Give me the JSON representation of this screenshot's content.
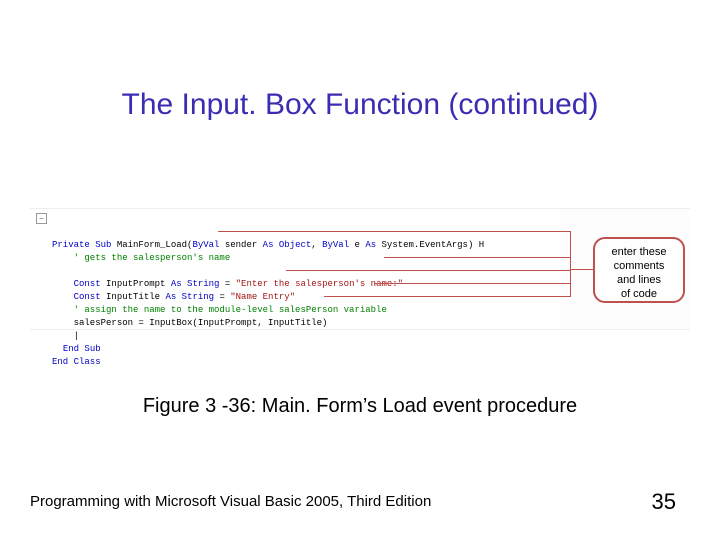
{
  "title": "The Input. Box Function (continued)",
  "code": {
    "collapse_glyph": "−",
    "line1": {
      "kw1": "Private Sub",
      "name": " MainForm_Load(",
      "kw2": "ByVal",
      "arg1": " sender ",
      "kw3": "As Object",
      "sep": ", ",
      "kw4": "ByVal",
      "arg2": " e ",
      "kw5": "As",
      "type": " System.EventArgs) H"
    },
    "comment1": "' gets the salesperson's name",
    "const1": {
      "kw": "Const",
      "name": " InputPrompt ",
      "kwAs": "As String",
      "eq": " = ",
      "str": "\"Enter the salesperson's name:\""
    },
    "const2": {
      "kw": "Const",
      "name": " InputTitle ",
      "kwAs": "As String",
      "eq": " = ",
      "str": "\"Name Entry\""
    },
    "comment2": "' assign the name to the module-level salesPerson variable",
    "assign": "salesPerson = InputBox(InputPrompt, InputTitle)",
    "endsub": "End Sub",
    "endclass": "End Class"
  },
  "callout": {
    "l1": "enter these",
    "l2": "comments",
    "l3": "and lines",
    "l4": "of code"
  },
  "caption": "Figure 3 -36: Main. Form’s Load event procedure",
  "footer": "Programming with Microsoft Visual Basic 2005, Third Edition",
  "pagenum": "35"
}
